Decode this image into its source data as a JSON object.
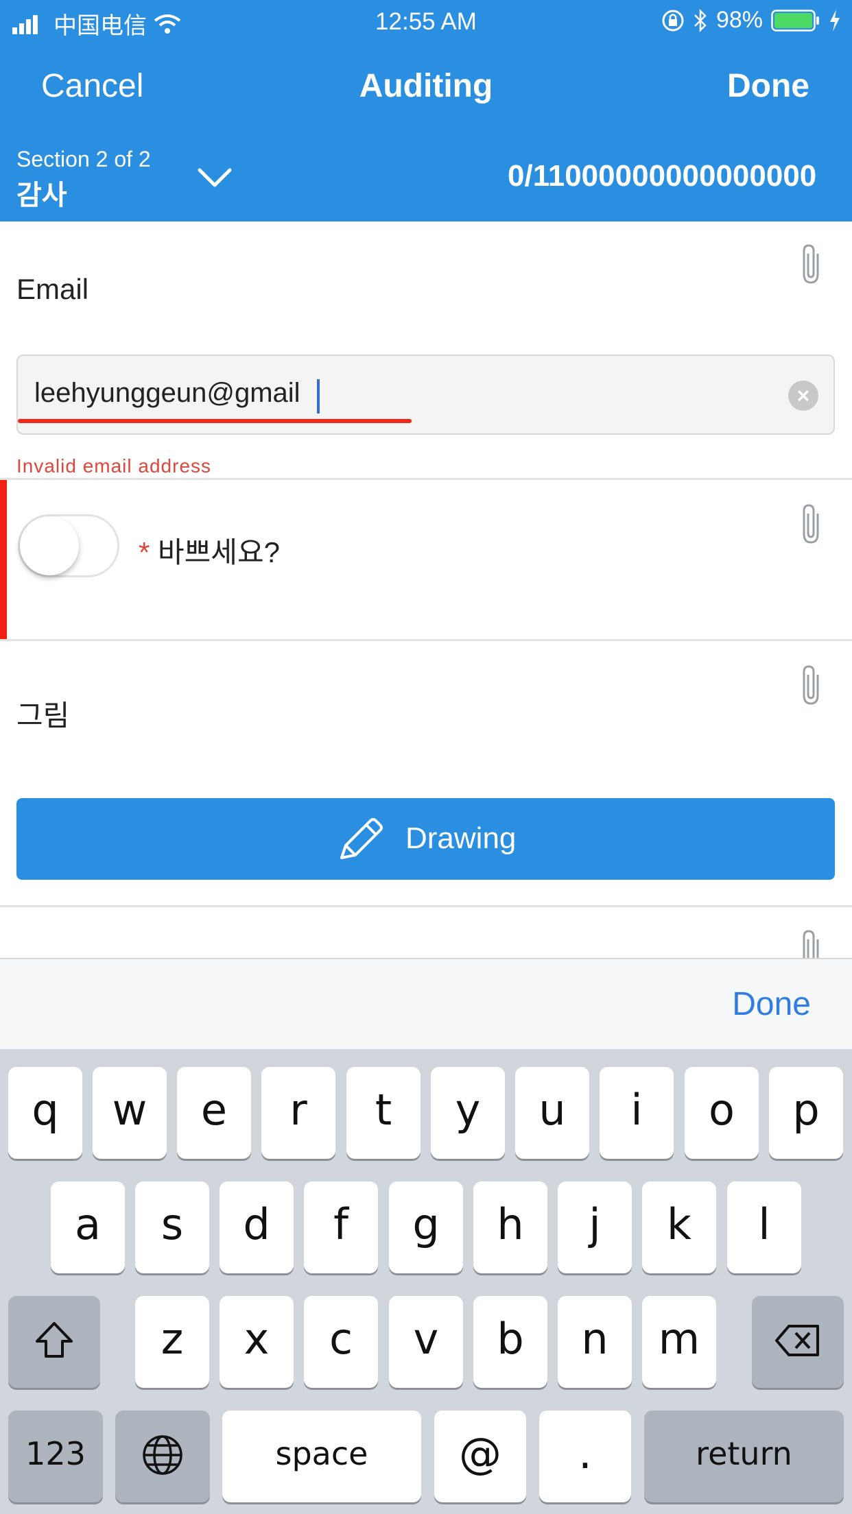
{
  "status_bar": {
    "carrier": "中国电信",
    "time": "12:55 AM",
    "battery": "98%"
  },
  "nav": {
    "cancel": "Cancel",
    "title": "Auditing",
    "done": "Done"
  },
  "section": {
    "label": "Section 2 of 2",
    "name": "감사",
    "counter": "0/11000000000000000"
  },
  "form": {
    "email": {
      "label": "Email",
      "value": "leehyunggeun@gmail",
      "error": "Invalid email address"
    },
    "busy": {
      "required_mark": "*",
      "label": "바쁘세요?"
    },
    "drawing": {
      "label": "그림",
      "button": "Drawing"
    }
  },
  "keyboard": {
    "toolbar_done": "Done",
    "row1": [
      "q",
      "w",
      "e",
      "r",
      "t",
      "y",
      "u",
      "i",
      "o",
      "p"
    ],
    "row2": [
      "a",
      "s",
      "d",
      "f",
      "g",
      "h",
      "j",
      "k",
      "l"
    ],
    "row3": [
      "z",
      "x",
      "c",
      "v",
      "b",
      "n",
      "m"
    ],
    "numbers": "123",
    "space": "space",
    "at": "@",
    "dot": ".",
    "return": "return"
  },
  "colors": {
    "accent": "#2a8ee1",
    "error": "#f21f14"
  }
}
